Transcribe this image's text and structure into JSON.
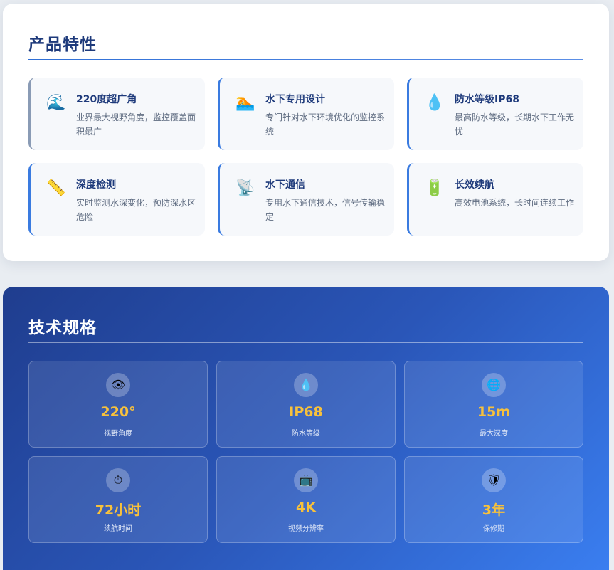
{
  "features": {
    "title": "产品特性",
    "items": [
      {
        "icon": "wave-icon",
        "glyph": "🌊",
        "title": "220度超广角",
        "desc": "业界最大视野角度，监控覆盖面积最广"
      },
      {
        "icon": "swimmer-icon",
        "glyph": "🏊",
        "title": "水下专用设计",
        "desc": "专门针对水下环境优化的监控系统"
      },
      {
        "icon": "droplet-icon",
        "glyph": "💧",
        "title": "防水等级IP68",
        "desc": "最高防水等级，长期水下工作无忧"
      },
      {
        "icon": "ruler-icon",
        "glyph": "📏",
        "title": "深度检测",
        "desc": "实时监测水深变化，预防深水区危险"
      },
      {
        "icon": "satellite-dish-icon",
        "glyph": "📡",
        "title": "水下通信",
        "desc": "专用水下通信技术，信号传输稳定"
      },
      {
        "icon": "battery-icon",
        "glyph": "🔋",
        "title": "长效续航",
        "desc": "高效电池系统，长时间连续工作"
      }
    ]
  },
  "specs": {
    "title": "技术规格",
    "items": [
      {
        "icon": "eye-icon",
        "glyph": "👁",
        "value": "220°",
        "label": "视野角度"
      },
      {
        "icon": "droplet-icon",
        "glyph": "💧",
        "value": "IP68",
        "label": "防水等级"
      },
      {
        "icon": "globe-icon",
        "glyph": "🌐",
        "value": "15m",
        "label": "最大深度"
      },
      {
        "icon": "stopwatch-icon",
        "glyph": "⏱",
        "value": "72小时",
        "label": "续航时间"
      },
      {
        "icon": "tv-icon",
        "glyph": "📺",
        "value": "4K",
        "label": "视频分辨率"
      },
      {
        "icon": "shield-icon",
        "glyph": "🛡",
        "value": "3年",
        "label": "保修期"
      }
    ]
  },
  "colors": {
    "accent": "#3a7be0",
    "title_blue": "#1e3a7b",
    "spec_value_gold": "#f7c13c"
  }
}
